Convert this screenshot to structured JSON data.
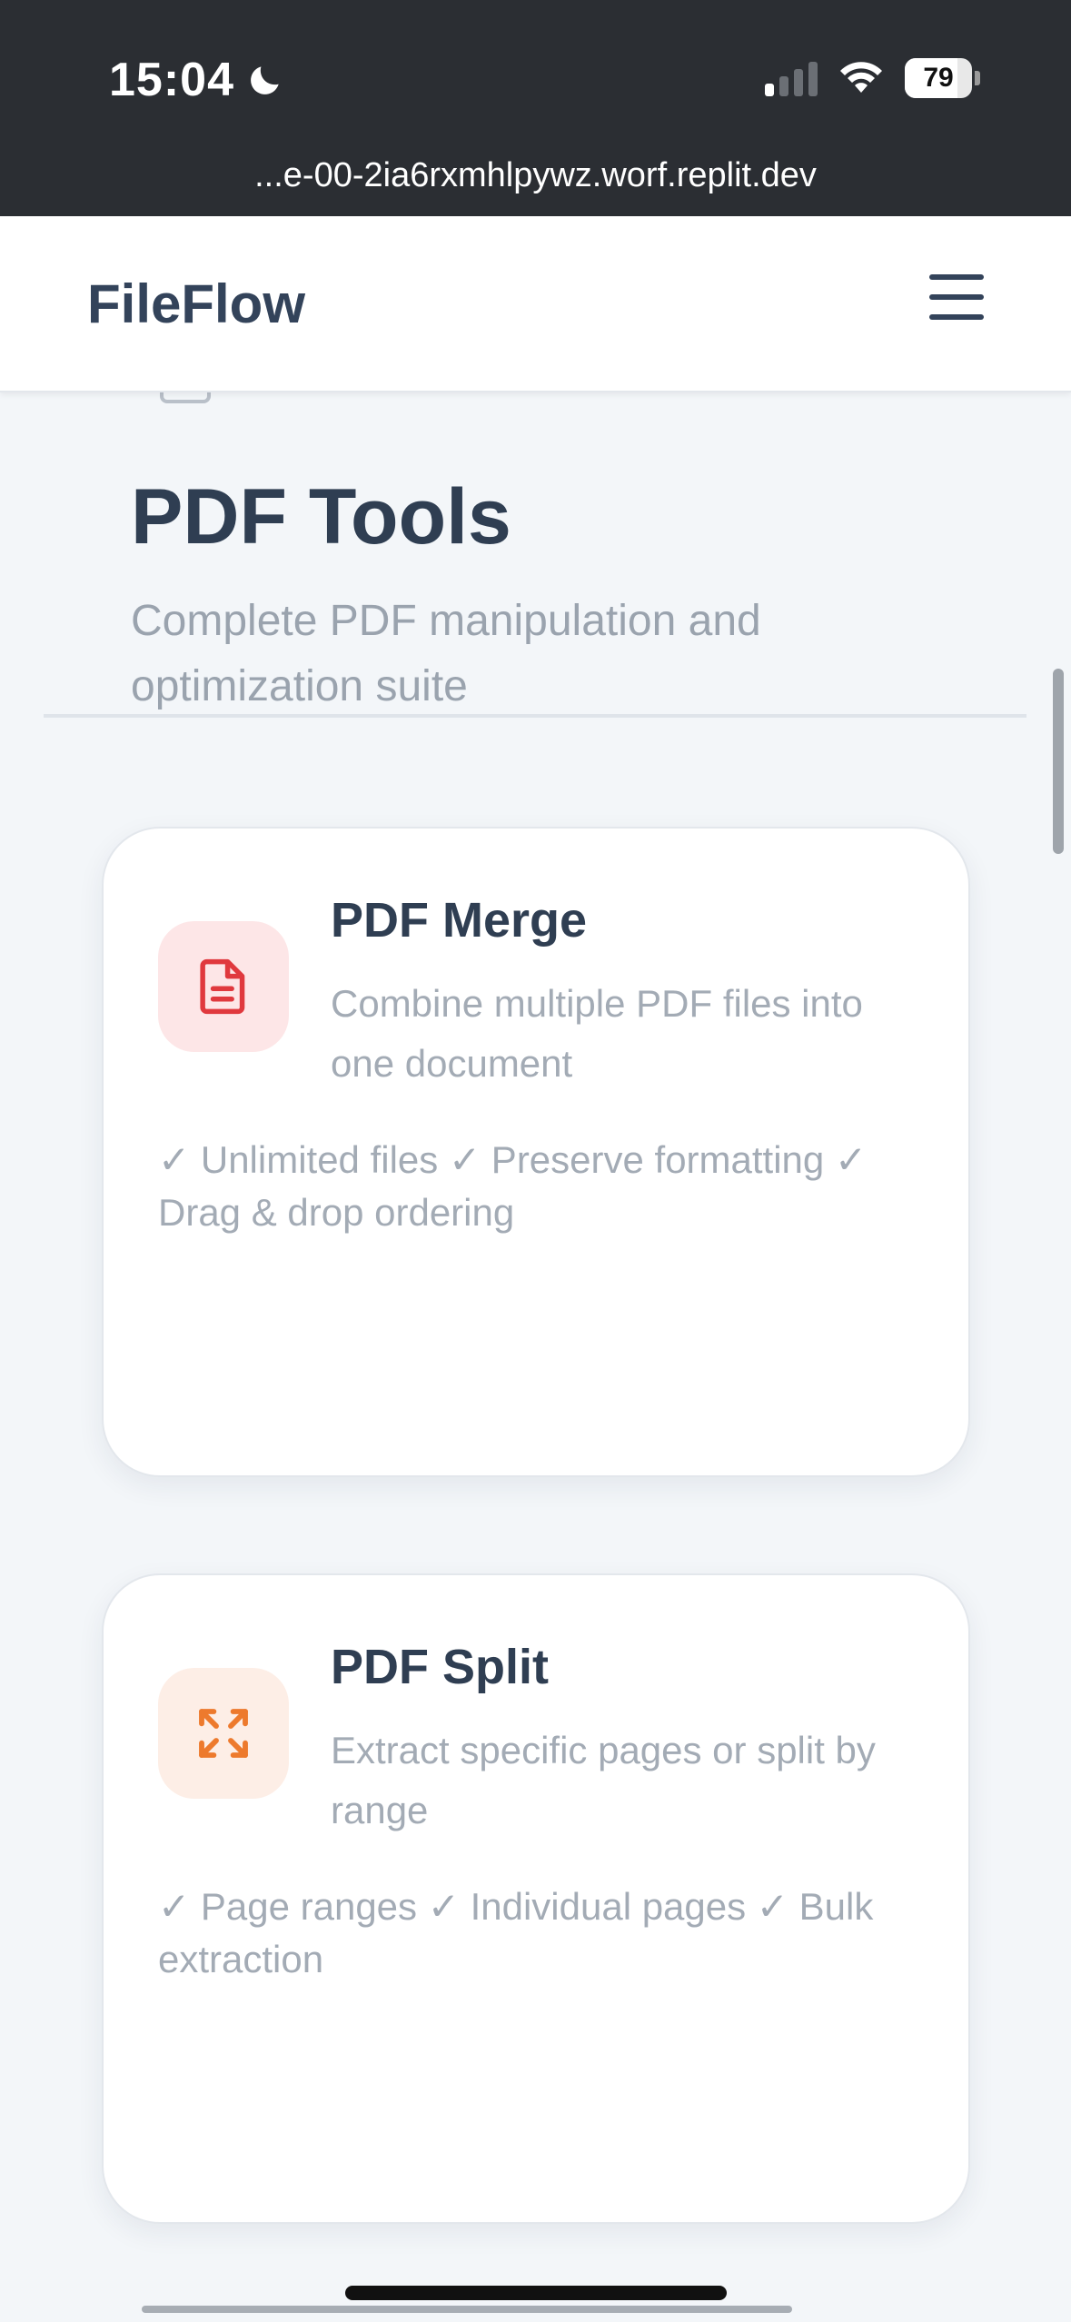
{
  "status_bar": {
    "time": "15:04",
    "battery": "79",
    "battery_fraction": 0.79,
    "signal_bars_active": 1,
    "url": "...e-00-2ia6rxmhlpywz.worf.replit.dev"
  },
  "app": {
    "brand": "FileFlow"
  },
  "page": {
    "title": "PDF Tools",
    "subtitle": "Complete PDF manipulation and optimization suite"
  },
  "tools": [
    {
      "title": "PDF Merge",
      "description": "Combine multiple PDF files into one document",
      "features": "✓ Unlimited files ✓ Preserve formatting ✓ Drag & drop ordering",
      "icon": "file-text-icon",
      "icon_color": "#e0393e",
      "icon_bg": "#fde6e7"
    },
    {
      "title": "PDF Split",
      "description": "Extract specific pages or split by range",
      "features": "✓ Page ranges ✓ Individual pages ✓ Bulk extraction",
      "icon": "expand-arrows-icon",
      "icon_color": "#ed7a2d",
      "icon_bg": "#fdeee6"
    }
  ],
  "colors": {
    "status_bar_bg": "#2b2e33",
    "page_bg": "#f3f6f9",
    "heading": "#2f3e52",
    "muted": "#a3abb5"
  }
}
